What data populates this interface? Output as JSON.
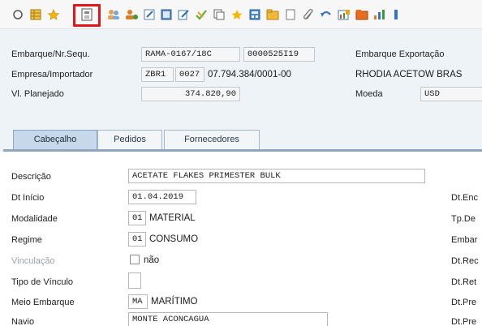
{
  "toolbar": {
    "icons": [
      "circle-icon",
      "grid-icon",
      "star-icon",
      "save-page-icon",
      "users-icon",
      "person-add-icon",
      "edit-icon",
      "document-icon",
      "edit-doc-icon",
      "check-icon",
      "copy-icon",
      "favorite-icon",
      "calculator-icon",
      "folder-icon",
      "page-icon",
      "attach-icon",
      "undo-icon",
      "chart-edit-icon",
      "folder-open-icon",
      "chart-icon",
      "info-icon"
    ]
  },
  "header": {
    "embarque_label": "Embarque/Nr.Sequ.",
    "embarque_value": "RAMA-0167/18C",
    "sequencia_value": "0000525I19",
    "empresa_label": "Empresa/Importador",
    "empresa_code": "ZBR1",
    "empresa_num": "0027",
    "empresa_cnpj": "07.794.384/0001-00",
    "vl_label": "Vl. Planejado",
    "vl_value": "374.820,90",
    "emb_exp_label": "Embarque Exportação",
    "rhodia": "RHODIA ACETOW BRAS",
    "moeda_label": "Moeda",
    "moeda_value": "USD"
  },
  "tabs": {
    "cabecalho": "Cabeçalho",
    "pedidos": "Pedidos",
    "fornecedores": "Fornecedores"
  },
  "form": {
    "descricao_label": "Descrição",
    "descricao_value": "ACETATE FLAKES PRIMESTER BULK",
    "dt_inicio_label": "Dt Início",
    "dt_inicio_value": "01.04.2019",
    "modalidade_label": "Modalidade",
    "modalidade_code": "01",
    "modalidade_text": "MATERIAL",
    "regime_label": "Regime",
    "regime_code": "01",
    "regime_text": "CONSUMO",
    "vinculacao_label": "Vinculação",
    "vinculacao_text": "não",
    "tipo_vinculo_label": "Tipo de Vínculo",
    "meio_label": "Meio Embarque",
    "meio_code": "MA",
    "meio_text": "MARÍTIMO",
    "navio_label": "Navio",
    "navio_value": "MONTE ACONCAGUA",
    "right_labels": [
      "Dt.Enc",
      "Tp.De",
      "Embar",
      "Dt.Rec",
      "Dt.Ret",
      "Dt.Pre",
      "Dt.Pre"
    ]
  }
}
